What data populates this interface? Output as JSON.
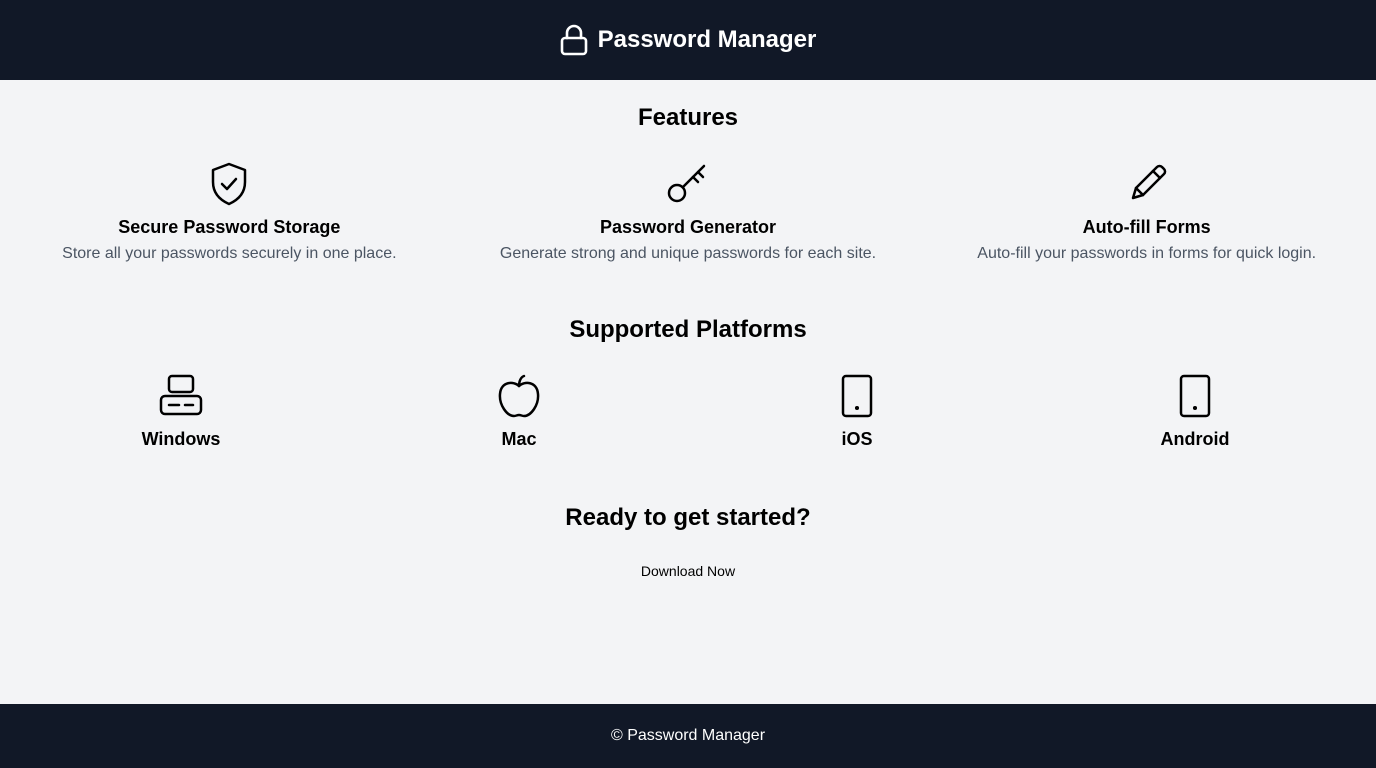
{
  "header": {
    "title": "Password Manager",
    "icon": "lock-icon"
  },
  "features": {
    "title": "Features",
    "items": [
      {
        "icon": "shield-check-icon",
        "title": "Secure Password Storage",
        "description": "Store all your passwords securely in one place."
      },
      {
        "icon": "key-icon",
        "title": "Password Generator",
        "description": "Generate strong and unique passwords for each site."
      },
      {
        "icon": "pencil-icon",
        "title": "Auto-fill Forms",
        "description": "Auto-fill your passwords in forms for quick login."
      }
    ]
  },
  "platforms": {
    "title": "Supported Platforms",
    "items": [
      {
        "icon": "computer-icon",
        "label": "Windows"
      },
      {
        "icon": "apple-icon",
        "label": "Mac"
      },
      {
        "icon": "phone-icon",
        "label": "iOS"
      },
      {
        "icon": "phone-icon",
        "label": "Android"
      }
    ]
  },
  "cta": {
    "title": "Ready to get started?",
    "button_label": "Download Now"
  },
  "footer": {
    "text": "© Password Manager"
  },
  "colors": {
    "header_bg": "#111827",
    "page_bg": "#f3f4f6",
    "muted_text": "#4b5563"
  }
}
